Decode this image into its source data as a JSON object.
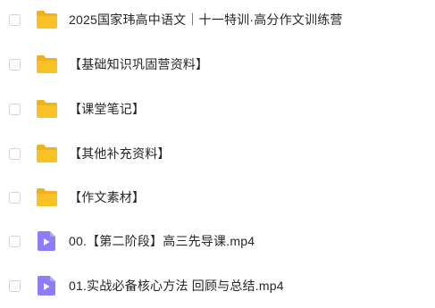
{
  "colors": {
    "folder": "#f8c226",
    "folder_tab": "#f2b01a",
    "video": "#8e7dfa",
    "text": "#262626",
    "checkbox_border": "#d0d3d8"
  },
  "items": [
    {
      "type": "folder",
      "icon": "folder-icon",
      "name": "2025国家玮高中语文｜十一特训·高分作文训练营"
    },
    {
      "type": "folder",
      "icon": "folder-icon",
      "name": "【基础知识巩固营资料】"
    },
    {
      "type": "folder",
      "icon": "folder-icon",
      "name": "【课堂笔记】"
    },
    {
      "type": "folder",
      "icon": "folder-icon",
      "name": "【其他补充资料】"
    },
    {
      "type": "folder",
      "icon": "folder-icon",
      "name": "【作文素材】"
    },
    {
      "type": "video",
      "icon": "video-file-icon",
      "name": "00.【第二阶段】高三先导课.mp4"
    },
    {
      "type": "video",
      "icon": "video-file-icon",
      "name": "01.实战必备核心方法 回顾与总结.mp4"
    }
  ]
}
